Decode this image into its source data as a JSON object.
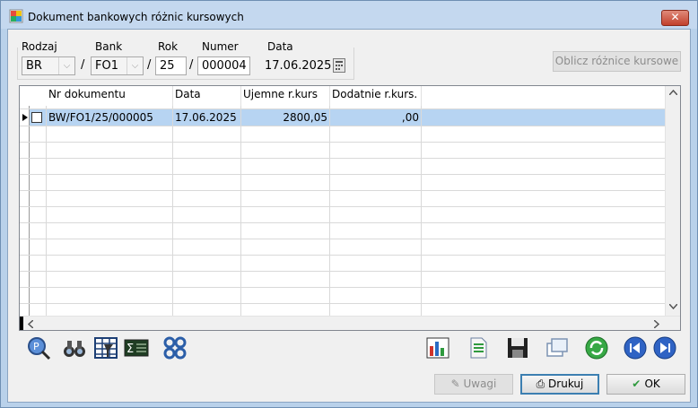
{
  "window": {
    "title": "Dokument bankowych różnic kursowych",
    "close_label": "✕"
  },
  "filters": {
    "rodzaj": {
      "label": "Rodzaj",
      "value": "BR"
    },
    "bank": {
      "label": "Bank",
      "value": "FO1"
    },
    "rok": {
      "label": "Rok",
      "value": "25"
    },
    "numer": {
      "label": "Numer",
      "value": "000004"
    },
    "data": {
      "label": "Data",
      "value": "17.06.2025"
    },
    "sep": "/"
  },
  "buttons": {
    "calculate": "Oblicz różnice kursowe",
    "notes": "Uwagi",
    "print": "Drukuj",
    "ok": "OK"
  },
  "table": {
    "columns": [
      "Nr dokumentu",
      "Data",
      "Ujemne r.kurs",
      "Dodatnie r.kurs."
    ],
    "rows": [
      {
        "nr": "BW/FO1/25/000005",
        "data": "17.06.2025",
        "ujemne": "2800,05",
        "dodatnie": ",00"
      }
    ]
  },
  "icons": {
    "toolbar_left": [
      "search-document-icon",
      "binoculars-icon",
      "table-filter-icon",
      "sum-icon",
      "settings-gears-icon"
    ],
    "toolbar_right": [
      "chart-icon",
      "document-icon",
      "save-icon",
      "windows-icon",
      "refresh-icon",
      "previous-icon",
      "next-icon"
    ]
  },
  "colors": {
    "selected_row": "#b7d4f2",
    "accent": "#3c7fb1"
  }
}
